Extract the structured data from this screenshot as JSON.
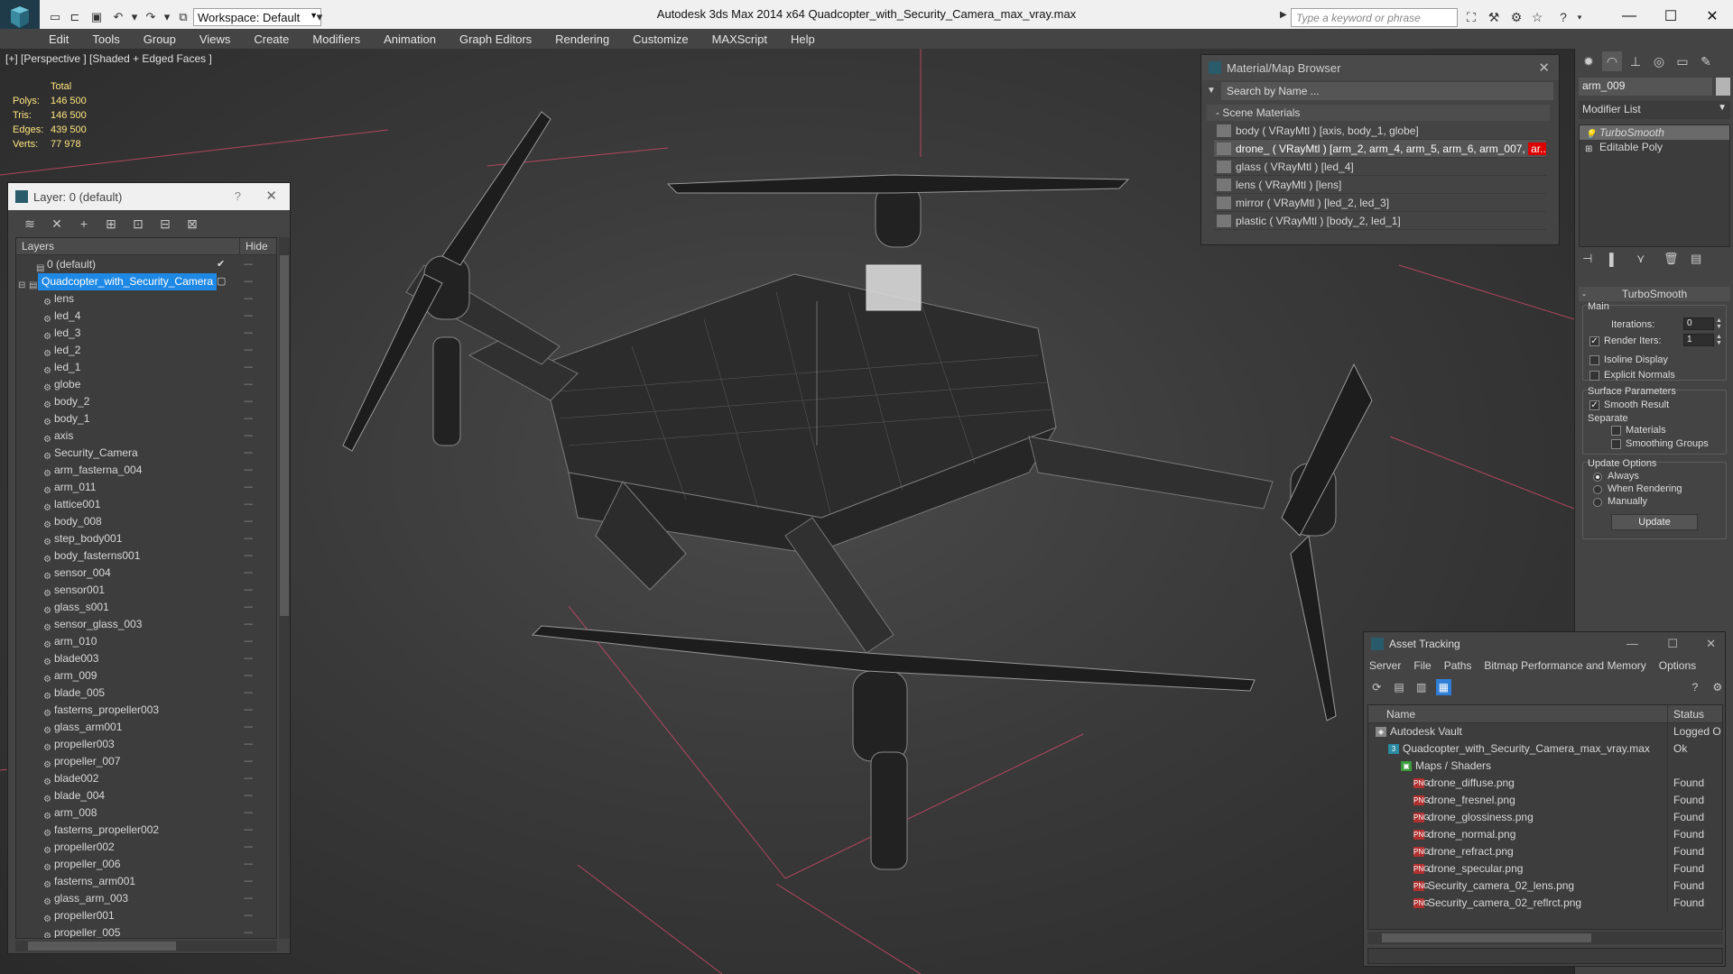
{
  "titlebar": {
    "workspace": "Workspace: Default",
    "title": "Autodesk 3ds Max  2014 x64      Quadcopter_with_Security_Camera_max_vray.max",
    "search_placeholder": "Type a keyword or phrase"
  },
  "menu": [
    "Edit",
    "Tools",
    "Group",
    "Views",
    "Create",
    "Modifiers",
    "Animation",
    "Graph Editors",
    "Rendering",
    "Customize",
    "MAXScript",
    "Help"
  ],
  "viewport": {
    "label": "[+] [Perspective ] [Shaded + Edged Faces ]",
    "stats": {
      "header": "Total",
      "rows": [
        {
          "label": "Polys:",
          "value": "146 500"
        },
        {
          "label": "Tris:",
          "value": "146 500"
        },
        {
          "label": "Edges:",
          "value": "439 500"
        },
        {
          "label": "Verts:",
          "value": "77 978"
        }
      ]
    }
  },
  "layer_panel": {
    "title": "Layer: 0 (default)",
    "help": "?",
    "col_layers": "Layers",
    "col_hide": "Hide",
    "root": "0 (default)",
    "selected": "Quadcopter_with_Security_Camera",
    "objects": [
      "lens",
      "led_4",
      "led_3",
      "led_2",
      "led_1",
      "globe",
      "body_2",
      "body_1",
      "axis",
      "Security_Camera",
      "arm_fasterna_004",
      "arm_011",
      "lattice001",
      "body_008",
      "step_body001",
      "body_fasterns001",
      "sensor_004",
      "sensor001",
      "glass_s001",
      "sensor_glass_003",
      "arm_010",
      "blade003",
      "arm_009",
      "blade_005",
      "fasterns_propeller003",
      "glass_arm001",
      "propeller003",
      "propeller_007",
      "blade002",
      "blade_004",
      "arm_008",
      "fasterns_propeller002",
      "propeller002",
      "propeller_006",
      "fasterns_arm001",
      "glass_arm_003",
      "propeller001",
      "propeller_005"
    ]
  },
  "material_browser": {
    "title": "Material/Map Browser",
    "search": "Search by Name ...",
    "section": "- Scene Materials",
    "materials": [
      {
        "text": "body  ( VRayMtl ) [axis, body_1, globe]",
        "red": ""
      },
      {
        "text": "drone_  ( VRayMtl )  [arm_2, arm_4, arm_5, arm_6, arm_007, ",
        "red": "ar..."
      },
      {
        "text": "glass  ( VRayMtl ) [led_4]",
        "red": ""
      },
      {
        "text": "lens  ( VRayMtl ) [lens]",
        "red": ""
      },
      {
        "text": "mirror  ( VRayMtl ) [led_2, led_3]",
        "red": ""
      },
      {
        "text": "plastic  ( VRayMtl ) [body_2, led_1]",
        "red": ""
      }
    ]
  },
  "command_panel": {
    "object_name": "arm_009",
    "modifier_list": "Modifier List",
    "stack": [
      "TurboSmooth",
      "Editable Poly"
    ],
    "turbosmooth": {
      "header": "TurboSmooth",
      "main": "Main",
      "iterations_label": "Iterations:",
      "iterations_value": "0",
      "render_iters_label": "Render Iters:",
      "render_iters_value": "1",
      "isoline": "Isoline Display",
      "explicit_normals": "Explicit Normals",
      "surface_params": "Surface Parameters",
      "smooth_result": "Smooth Result",
      "separate": "Separate",
      "materials": "Materials",
      "smoothing_groups": "Smoothing Groups",
      "update_options": "Update Options",
      "always": "Always",
      "when_rendering": "When Rendering",
      "manually": "Manually",
      "update": "Update"
    }
  },
  "asset_tracking": {
    "title": "Asset Tracking",
    "menu": [
      "Server",
      "File",
      "Paths",
      "Bitmap Performance and Memory",
      "Options"
    ],
    "col_name": "Name",
    "col_status": "Status",
    "rows": [
      {
        "name": "Autodesk Vault",
        "status": "Logged O",
        "level": 0,
        "icon": "vault"
      },
      {
        "name": "Quadcopter_with_Security_Camera_max_vray.max",
        "status": "Ok",
        "level": 1,
        "icon": "max"
      },
      {
        "name": "Maps / Shaders",
        "status": "",
        "level": 2,
        "icon": "maps"
      },
      {
        "name": "drone_diffuse.png",
        "status": "Found",
        "level": 3,
        "icon": "png"
      },
      {
        "name": "drone_fresnel.png",
        "status": "Found",
        "level": 3,
        "icon": "png"
      },
      {
        "name": "drone_glossiness.png",
        "status": "Found",
        "level": 3,
        "icon": "png"
      },
      {
        "name": "drone_normal.png",
        "status": "Found",
        "level": 3,
        "icon": "png"
      },
      {
        "name": "drone_refract.png",
        "status": "Found",
        "level": 3,
        "icon": "png"
      },
      {
        "name": "drone_specular.png",
        "status": "Found",
        "level": 3,
        "icon": "png"
      },
      {
        "name": "Security_camera_02_lens.png",
        "status": "Found",
        "level": 3,
        "icon": "png"
      },
      {
        "name": "Security_camera_02_reflrct.png",
        "status": "Found",
        "level": 3,
        "icon": "png"
      }
    ]
  }
}
